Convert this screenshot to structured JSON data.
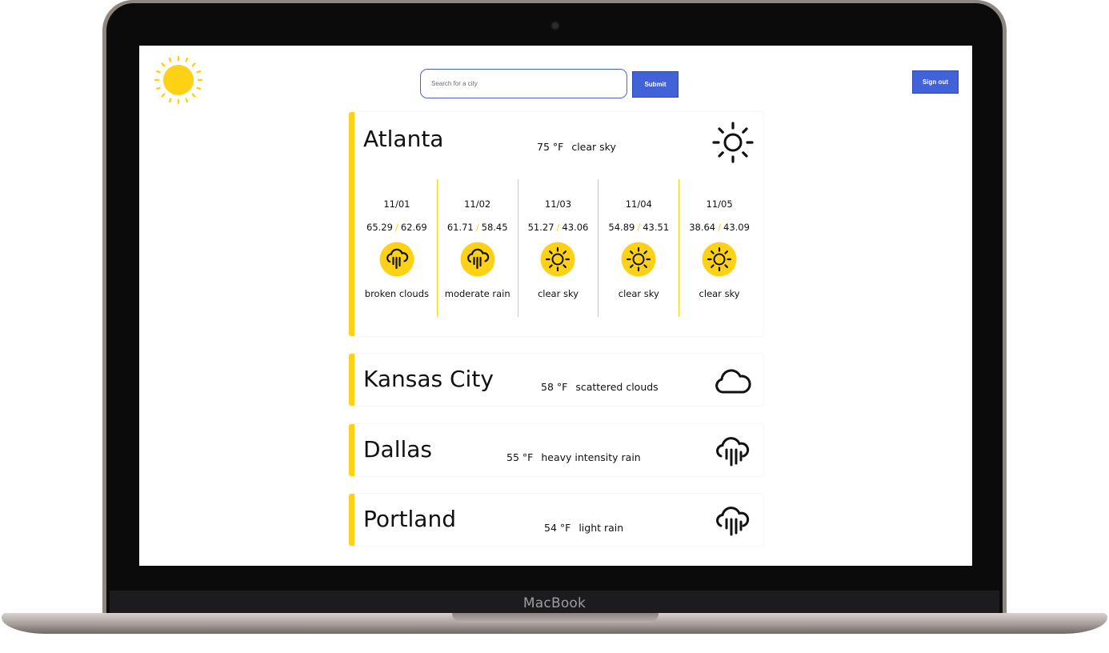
{
  "device": {
    "brand": "MacBook"
  },
  "app": {
    "logo_icon": "sun-icon",
    "search": {
      "placeholder": "Search for a city",
      "value": ""
    },
    "submit_label": "Submit",
    "signout_label": "Sign out",
    "colors": {
      "accent": "#fcd116",
      "button": "#4262d8",
      "input_border": "#4a63d3"
    }
  },
  "cities": [
    {
      "name": "Atlanta",
      "temp": "75",
      "unit": "°F",
      "desc": "clear sky",
      "icon": "sun-outline-icon",
      "forecast": [
        {
          "date": "11/01",
          "hi": "65.29",
          "lo": "62.69",
          "desc": "broken clouds",
          "icon": "cloud-rain-icon"
        },
        {
          "date": "11/02",
          "hi": "61.71",
          "lo": "58.45",
          "desc": "moderate rain",
          "icon": "cloud-rain-icon"
        },
        {
          "date": "11/03",
          "hi": "51.27",
          "lo": "43.06",
          "desc": "clear sky",
          "icon": "sun-icon"
        },
        {
          "date": "11/04",
          "hi": "54.89",
          "lo": "43.51",
          "desc": "clear sky",
          "icon": "sun-icon"
        },
        {
          "date": "11/05",
          "hi": "38.64",
          "lo": "43.09",
          "desc": "clear sky",
          "icon": "sun-icon"
        }
      ]
    },
    {
      "name": "Kansas City",
      "temp": "58",
      "unit": "°F",
      "desc": "scattered clouds",
      "icon": "cloud-icon"
    },
    {
      "name": "Dallas",
      "temp": "55",
      "unit": "°F",
      "desc": "heavy intensity rain",
      "icon": "cloud-rain-icon"
    },
    {
      "name": "Portland",
      "temp": "54",
      "unit": "°F",
      "desc": "light rain",
      "icon": "cloud-rain-icon"
    }
  ]
}
